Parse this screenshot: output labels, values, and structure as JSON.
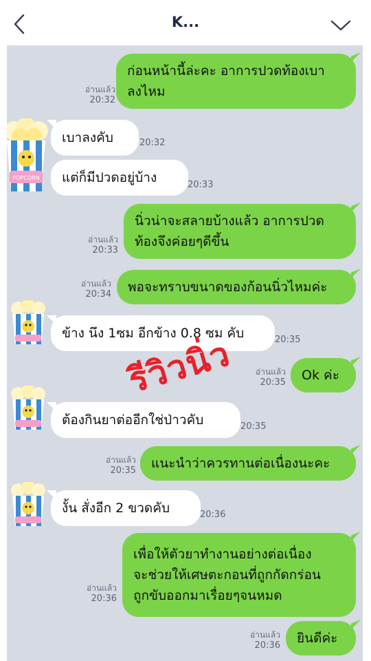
{
  "header": {
    "title": "K..."
  },
  "read_label": "อ่านแล้ว",
  "messages": [
    {
      "text": "ก่อนหน้านี้ล่ะคะ อาการปวดท้องเบา\nลงไหม",
      "time": "20:32"
    },
    {
      "text": "เบาลงคับ",
      "time": "20:32"
    },
    {
      "text": "แต่ก็มีปวดอยู่บ้าง",
      "time": "20:33"
    },
    {
      "text": "นิ่วน่าจะสลายบ้างแล้ว อาการปวด\nท้องจึงค่อยๆดีขึ้น",
      "time": "20:33"
    },
    {
      "text": "พอจะทราบขนาดของก้อนนิ่วไหมค่ะ",
      "time": "20:34"
    },
    {
      "text": "ข้าง นึง 1ซม อีกข้าง 0.8 ซม คับ",
      "time": "20:35"
    },
    {
      "text": "Ok ค่ะ",
      "time": "20:35"
    },
    {
      "text": "ต้องกินยาต่ออีกใช่ป่าวคับ",
      "time": "20:35"
    },
    {
      "text": "แนะนำว่าควรทานต่อเนื่องนะคะ",
      "time": "20:35"
    },
    {
      "text": "งั้น สั่งอีก 2 ขวดคับ",
      "time": "20:36"
    },
    {
      "text": "เพื่อให้ตัวยาทำงานอย่างต่อเนื่อง\nจะช่วยให้เศษตะกอนที่ถูกกัดกร่อน\nถูกขับออกมาเรื่อยๆจนหมด",
      "time": "20:36"
    },
    {
      "text": "ยินดีค่ะ",
      "time": "20:36"
    }
  ],
  "watermark": "รีวิวนิ่ว",
  "avatar_label": "POPCORN",
  "colors": {
    "outgoing": "#7bd448",
    "incoming": "#ffffff",
    "background": "#d5dae3"
  }
}
